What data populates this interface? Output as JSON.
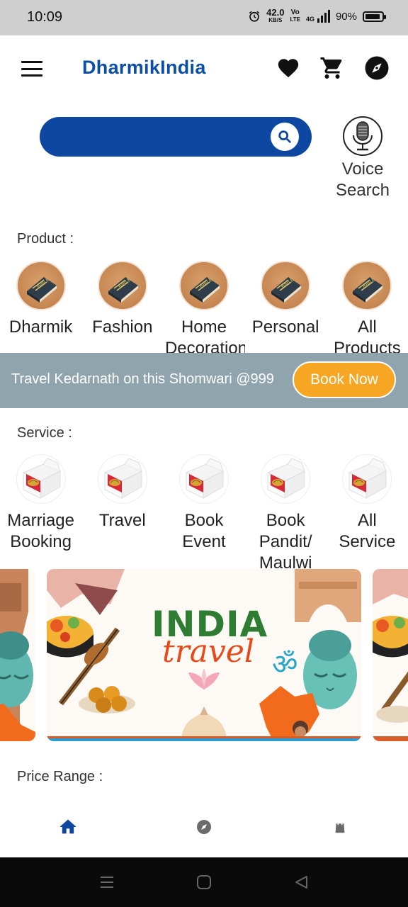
{
  "status_bar": {
    "time": "10:09",
    "net_speed_value": "42.0",
    "net_speed_unit": "KB/S",
    "volte_top": "Vo",
    "volte_bottom": "LTE",
    "network": "4G",
    "battery": "90%",
    "battery_level": 0.9
  },
  "header": {
    "title": "DharmikIndia",
    "icons": [
      "menu-icon",
      "heart-icon",
      "cart-icon",
      "compass-icon"
    ]
  },
  "search": {
    "placeholder": "",
    "voice_label_line1": "Voice",
    "voice_label_line2": "Search"
  },
  "products": {
    "title": "Product :",
    "items": [
      {
        "label": "Dharmik"
      },
      {
        "label": "Fashion"
      },
      {
        "label": "Home Decoration"
      },
      {
        "label": "Personal"
      },
      {
        "label": "All Products"
      }
    ]
  },
  "promo": {
    "text": "Travel Kedarnath on this Shomwari @999",
    "button": "Book Now",
    "bg_color": "#90a4ae",
    "button_color": "#f6a623"
  },
  "services": {
    "title": "Service :",
    "items": [
      {
        "label": "Marriage Booking"
      },
      {
        "label": "Travel"
      },
      {
        "label": "Book Event"
      },
      {
        "label": "Book Pandit/ Maulwi"
      },
      {
        "label": "All Service"
      }
    ]
  },
  "banner": {
    "line1": "INDIA",
    "line2": "travel"
  },
  "price_range": {
    "title": "Price Range :"
  },
  "bottom_nav": {
    "items": [
      "home-icon",
      "compass-icon",
      "bag-icon"
    ],
    "active": "home"
  },
  "colors": {
    "brand": "#0d4ea6",
    "search_bar": "#0d47a1"
  }
}
